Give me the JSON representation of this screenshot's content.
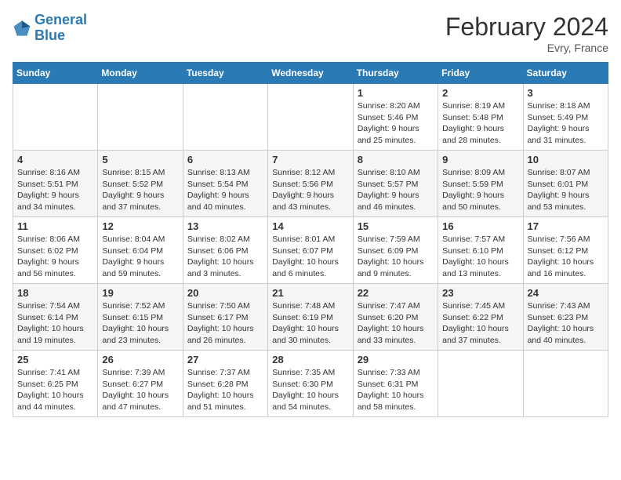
{
  "header": {
    "logo_line1": "General",
    "logo_line2": "Blue",
    "month": "February 2024",
    "location": "Evry, France"
  },
  "weekdays": [
    "Sunday",
    "Monday",
    "Tuesday",
    "Wednesday",
    "Thursday",
    "Friday",
    "Saturday"
  ],
  "weeks": [
    [
      {
        "day": "",
        "info": ""
      },
      {
        "day": "",
        "info": ""
      },
      {
        "day": "",
        "info": ""
      },
      {
        "day": "",
        "info": ""
      },
      {
        "day": "1",
        "info": "Sunrise: 8:20 AM\nSunset: 5:46 PM\nDaylight: 9 hours\nand 25 minutes."
      },
      {
        "day": "2",
        "info": "Sunrise: 8:19 AM\nSunset: 5:48 PM\nDaylight: 9 hours\nand 28 minutes."
      },
      {
        "day": "3",
        "info": "Sunrise: 8:18 AM\nSunset: 5:49 PM\nDaylight: 9 hours\nand 31 minutes."
      }
    ],
    [
      {
        "day": "4",
        "info": "Sunrise: 8:16 AM\nSunset: 5:51 PM\nDaylight: 9 hours\nand 34 minutes."
      },
      {
        "day": "5",
        "info": "Sunrise: 8:15 AM\nSunset: 5:52 PM\nDaylight: 9 hours\nand 37 minutes."
      },
      {
        "day": "6",
        "info": "Sunrise: 8:13 AM\nSunset: 5:54 PM\nDaylight: 9 hours\nand 40 minutes."
      },
      {
        "day": "7",
        "info": "Sunrise: 8:12 AM\nSunset: 5:56 PM\nDaylight: 9 hours\nand 43 minutes."
      },
      {
        "day": "8",
        "info": "Sunrise: 8:10 AM\nSunset: 5:57 PM\nDaylight: 9 hours\nand 46 minutes."
      },
      {
        "day": "9",
        "info": "Sunrise: 8:09 AM\nSunset: 5:59 PM\nDaylight: 9 hours\nand 50 minutes."
      },
      {
        "day": "10",
        "info": "Sunrise: 8:07 AM\nSunset: 6:01 PM\nDaylight: 9 hours\nand 53 minutes."
      }
    ],
    [
      {
        "day": "11",
        "info": "Sunrise: 8:06 AM\nSunset: 6:02 PM\nDaylight: 9 hours\nand 56 minutes."
      },
      {
        "day": "12",
        "info": "Sunrise: 8:04 AM\nSunset: 6:04 PM\nDaylight: 9 hours\nand 59 minutes."
      },
      {
        "day": "13",
        "info": "Sunrise: 8:02 AM\nSunset: 6:06 PM\nDaylight: 10 hours\nand 3 minutes."
      },
      {
        "day": "14",
        "info": "Sunrise: 8:01 AM\nSunset: 6:07 PM\nDaylight: 10 hours\nand 6 minutes."
      },
      {
        "day": "15",
        "info": "Sunrise: 7:59 AM\nSunset: 6:09 PM\nDaylight: 10 hours\nand 9 minutes."
      },
      {
        "day": "16",
        "info": "Sunrise: 7:57 AM\nSunset: 6:10 PM\nDaylight: 10 hours\nand 13 minutes."
      },
      {
        "day": "17",
        "info": "Sunrise: 7:56 AM\nSunset: 6:12 PM\nDaylight: 10 hours\nand 16 minutes."
      }
    ],
    [
      {
        "day": "18",
        "info": "Sunrise: 7:54 AM\nSunset: 6:14 PM\nDaylight: 10 hours\nand 19 minutes."
      },
      {
        "day": "19",
        "info": "Sunrise: 7:52 AM\nSunset: 6:15 PM\nDaylight: 10 hours\nand 23 minutes."
      },
      {
        "day": "20",
        "info": "Sunrise: 7:50 AM\nSunset: 6:17 PM\nDaylight: 10 hours\nand 26 minutes."
      },
      {
        "day": "21",
        "info": "Sunrise: 7:48 AM\nSunset: 6:19 PM\nDaylight: 10 hours\nand 30 minutes."
      },
      {
        "day": "22",
        "info": "Sunrise: 7:47 AM\nSunset: 6:20 PM\nDaylight: 10 hours\nand 33 minutes."
      },
      {
        "day": "23",
        "info": "Sunrise: 7:45 AM\nSunset: 6:22 PM\nDaylight: 10 hours\nand 37 minutes."
      },
      {
        "day": "24",
        "info": "Sunrise: 7:43 AM\nSunset: 6:23 PM\nDaylight: 10 hours\nand 40 minutes."
      }
    ],
    [
      {
        "day": "25",
        "info": "Sunrise: 7:41 AM\nSunset: 6:25 PM\nDaylight: 10 hours\nand 44 minutes."
      },
      {
        "day": "26",
        "info": "Sunrise: 7:39 AM\nSunset: 6:27 PM\nDaylight: 10 hours\nand 47 minutes."
      },
      {
        "day": "27",
        "info": "Sunrise: 7:37 AM\nSunset: 6:28 PM\nDaylight: 10 hours\nand 51 minutes."
      },
      {
        "day": "28",
        "info": "Sunrise: 7:35 AM\nSunset: 6:30 PM\nDaylight: 10 hours\nand 54 minutes."
      },
      {
        "day": "29",
        "info": "Sunrise: 7:33 AM\nSunset: 6:31 PM\nDaylight: 10 hours\nand 58 minutes."
      },
      {
        "day": "",
        "info": ""
      },
      {
        "day": "",
        "info": ""
      }
    ]
  ]
}
